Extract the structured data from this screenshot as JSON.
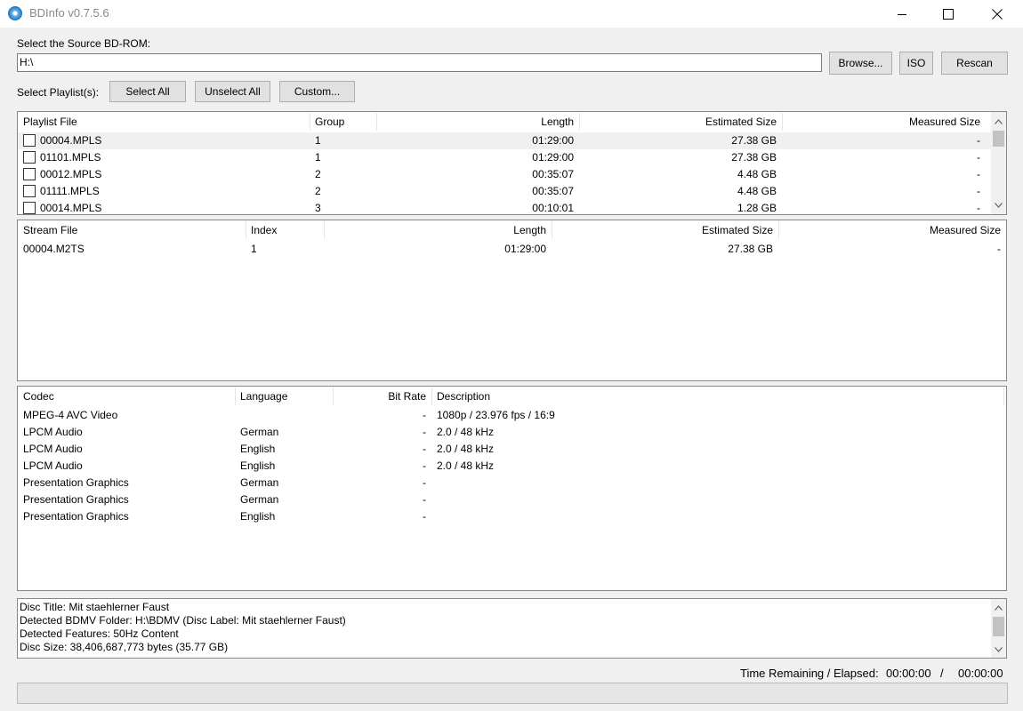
{
  "window": {
    "title": "BDInfo v0.7.5.6"
  },
  "source": {
    "label": "Select the Source BD-ROM:",
    "path": "H:\\",
    "browse_label": "Browse...",
    "iso_label": "ISO",
    "rescan_label": "Rescan"
  },
  "playlists": {
    "label": "Select Playlist(s):",
    "select_all_label": "Select All",
    "unselect_all_label": "Unselect All",
    "custom_label": "Custom...",
    "columns": [
      "Playlist File",
      "Group",
      "Length",
      "Estimated Size",
      "Measured Size"
    ],
    "rows": [
      [
        "00004.MPLS",
        "1",
        "01:29:00",
        "27.38 GB",
        "-"
      ],
      [
        "01101.MPLS",
        "1",
        "01:29:00",
        "27.38 GB",
        "-"
      ],
      [
        "00012.MPLS",
        "2",
        "00:35:07",
        "4.48 GB",
        "-"
      ],
      [
        "01111.MPLS",
        "2",
        "00:35:07",
        "4.48 GB",
        "-"
      ],
      [
        "00014.MPLS",
        "3",
        "00:10:01",
        "1.28 GB",
        "-"
      ]
    ]
  },
  "streams": {
    "columns": [
      "Stream File",
      "Index",
      "Length",
      "Estimated Size",
      "Measured Size"
    ],
    "rows": [
      [
        "00004.M2TS",
        "1",
        "01:29:00",
        "27.38 GB",
        "-"
      ]
    ]
  },
  "codecs": {
    "columns": [
      "Codec",
      "Language",
      "Bit Rate",
      "Description"
    ],
    "rows": [
      [
        "MPEG-4 AVC Video",
        "",
        "-",
        "1080p / 23.976 fps / 16:9"
      ],
      [
        "LPCM Audio",
        "German",
        "-",
        "2.0 / 48 kHz"
      ],
      [
        "LPCM Audio",
        "English",
        "-",
        "2.0 / 48 kHz"
      ],
      [
        "LPCM Audio",
        "English",
        "-",
        "2.0 / 48 kHz"
      ],
      [
        "Presentation Graphics",
        "German",
        "-",
        ""
      ],
      [
        "Presentation Graphics",
        "German",
        "-",
        ""
      ],
      [
        "Presentation Graphics",
        "English",
        "-",
        ""
      ]
    ]
  },
  "disc_info": [
    "Disc Title: Mit staehlerner Faust",
    "Detected BDMV Folder: H:\\BDMV (Disc Label: Mit staehlerner Faust)",
    "Detected Features: 50Hz Content",
    "Disc Size: 38,406,687,773 bytes (35.77 GB)"
  ],
  "status": {
    "time_label": "Time Remaining / Elapsed:",
    "remaining": "00:00:00",
    "separator": "/",
    "elapsed": "00:00:00"
  },
  "progress": {
    "fraction": 0
  }
}
